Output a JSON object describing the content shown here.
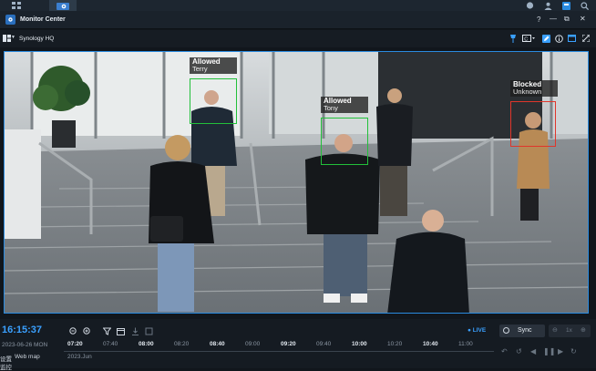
{
  "topbar": {
    "tabs": [
      "apps-grid-icon",
      "monitor-center-tab-icon"
    ],
    "right_icons": [
      "chat-icon",
      "user-icon",
      "widgets-icon",
      "search-icon"
    ]
  },
  "window": {
    "title": "Monitor Center",
    "controls": [
      "?",
      "—",
      "⧉",
      "✕"
    ]
  },
  "toolbar": {
    "location": "Synology HQ"
  },
  "detections": [
    {
      "status": "Allowed",
      "name": "Terry",
      "color": "#22c03a"
    },
    {
      "status": "Allowed",
      "name": "Tony",
      "color": "#22c03a"
    },
    {
      "status": "Blocked",
      "name": "Unknown",
      "color": "#e0362b"
    }
  ],
  "timeline": {
    "clock": "16:15:37",
    "date": "2023-06-26 MON",
    "month": "2023.Jun",
    "live_label": "LIVE",
    "sync_label": "Sync",
    "speed_label": "1x",
    "ticks": [
      {
        "label": "07:20",
        "bold": true
      },
      {
        "label": "07:40",
        "bold": false
      },
      {
        "label": "08:00",
        "bold": true
      },
      {
        "label": "08:20",
        "bold": false
      },
      {
        "label": "08:40",
        "bold": true
      },
      {
        "label": "09:00",
        "bold": false
      },
      {
        "label": "09:20",
        "bold": true
      },
      {
        "label": "09:40",
        "bold": false
      },
      {
        "label": "10:00",
        "bold": true
      },
      {
        "label": "10:20",
        "bold": false
      },
      {
        "label": "10:40",
        "bold": true
      },
      {
        "label": "11:00",
        "bold": false
      }
    ],
    "row1_label": "设置",
    "row1_value": "Web map",
    "row2_label": "监控"
  },
  "colors": {
    "accent": "#2a8be0",
    "clock": "#3aa0ff",
    "live": "#3aa0ff"
  }
}
